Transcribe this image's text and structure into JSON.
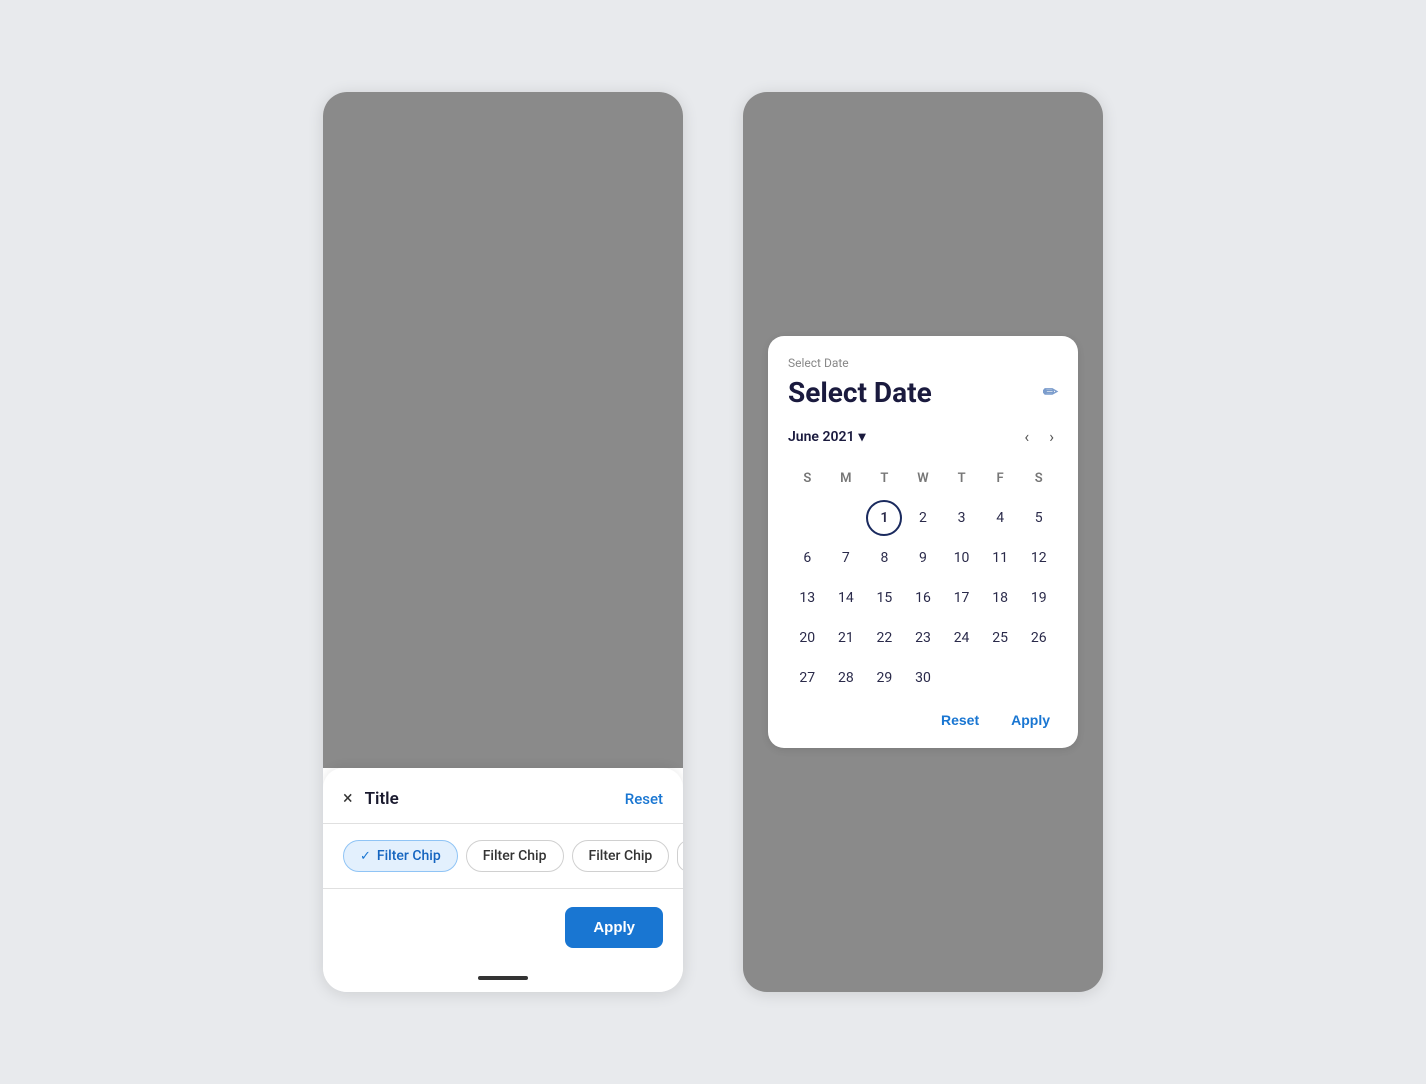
{
  "left_panel": {
    "sheet": {
      "title": "Title",
      "reset_label": "Reset",
      "close_icon": "×",
      "chips": [
        {
          "id": 1,
          "label": "Filter Chip",
          "selected": true
        },
        {
          "id": 2,
          "label": "Filter Chip",
          "selected": false
        },
        {
          "id": 3,
          "label": "Filter Chip",
          "selected": false
        },
        {
          "id": 4,
          "label": "",
          "selected": false,
          "partial": true
        }
      ],
      "apply_label": "Apply"
    }
  },
  "right_panel": {
    "calendar": {
      "card_label": "Select Date",
      "heading": "Select Date",
      "edit_icon": "✏",
      "month": "June 2021",
      "dropdown_icon": "▾",
      "nav_prev": "‹",
      "nav_next": "›",
      "weekdays": [
        "S",
        "M",
        "T",
        "W",
        "T",
        "F",
        "S"
      ],
      "weeks": [
        [
          null,
          null,
          "1",
          "2",
          "3",
          "4",
          "5"
        ],
        [
          "6",
          "7",
          "8",
          "9",
          "10",
          "11",
          "12"
        ],
        [
          "13",
          "14",
          "15",
          "16",
          "17",
          "18",
          "19"
        ],
        [
          "20",
          "21",
          "22",
          "23",
          "24",
          "25",
          "26"
        ],
        [
          "27",
          "28",
          "29",
          "30",
          null,
          null,
          null
        ]
      ],
      "selected_day": "1",
      "reset_label": "Reset",
      "apply_label": "Apply"
    }
  }
}
